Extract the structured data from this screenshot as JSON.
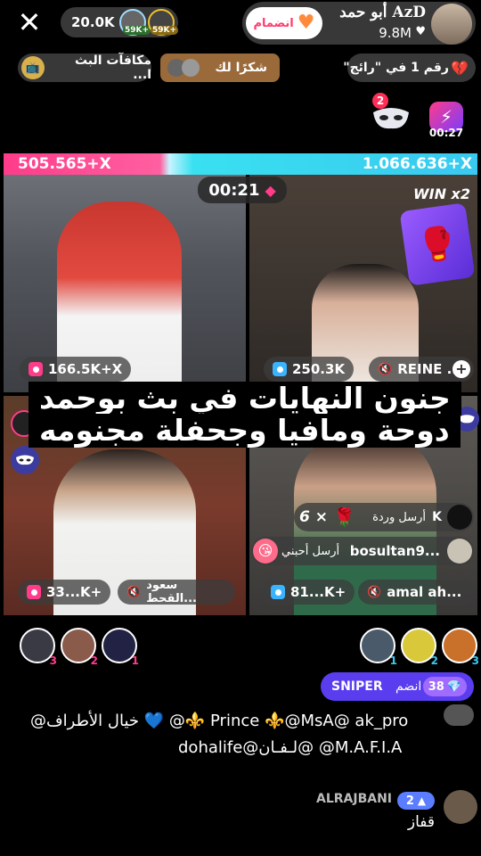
{
  "header": {
    "viewers": "20.0K",
    "viewer_badges": [
      "59K+",
      "59K+"
    ],
    "host_name": "أبو حمد AzD",
    "host_likes": "9.8M",
    "join_label": "انضمام"
  },
  "tags": {
    "rewards": "مكافآت البث ا...",
    "thanks": "شكرًا لك",
    "rank": "رقم 1 في \"رائج\""
  },
  "top_right": {
    "mask_count": "2",
    "timer": "00:27"
  },
  "battle": {
    "left_score": "505.565+X",
    "right_score": "1.066.636+X",
    "timer": "00:21",
    "win_label": "WIN x2"
  },
  "tiles": {
    "tl_score": "166.5K+X",
    "tr_score": "250.3K",
    "tr_name": "REINE ...",
    "bl_score": "33...K+",
    "bl_name": "سعود القحط...",
    "br_score": "81...K+",
    "br_name": "amal ah..."
  },
  "caption": {
    "line1": "جنون النهايات في بث بوحمد",
    "line2": "دوحة ومافيا وجحفلة مجنومه"
  },
  "gifts": {
    "g1_user": "K",
    "g1_text": "أرسل وردة",
    "g1_count": "6",
    "g2_user": "bosultan9...",
    "g2_text": "أرسل أحبني"
  },
  "ranks": {
    "left": [
      "3",
      "2",
      "1"
    ],
    "right": [
      "1",
      "2",
      "3"
    ]
  },
  "sniper": {
    "label": "SNIPER",
    "join": "انضم",
    "level": "38"
  },
  "comments": [
    {
      "line1": "@خيال الأطراف 💙 @⚜️ Prince ⚜️@MsA@ ak_pro",
      "line2": "dohalife@لـفـان@    @M.A.F.I.A"
    },
    {
      "user": "ALRAJBANI",
      "level": "2",
      "text": "قفاز"
    }
  ],
  "colors": {
    "accent_cyan": "#39e0f0",
    "accent_pink": "#ff3c8a",
    "sniper_bg": "#5b3df0"
  }
}
